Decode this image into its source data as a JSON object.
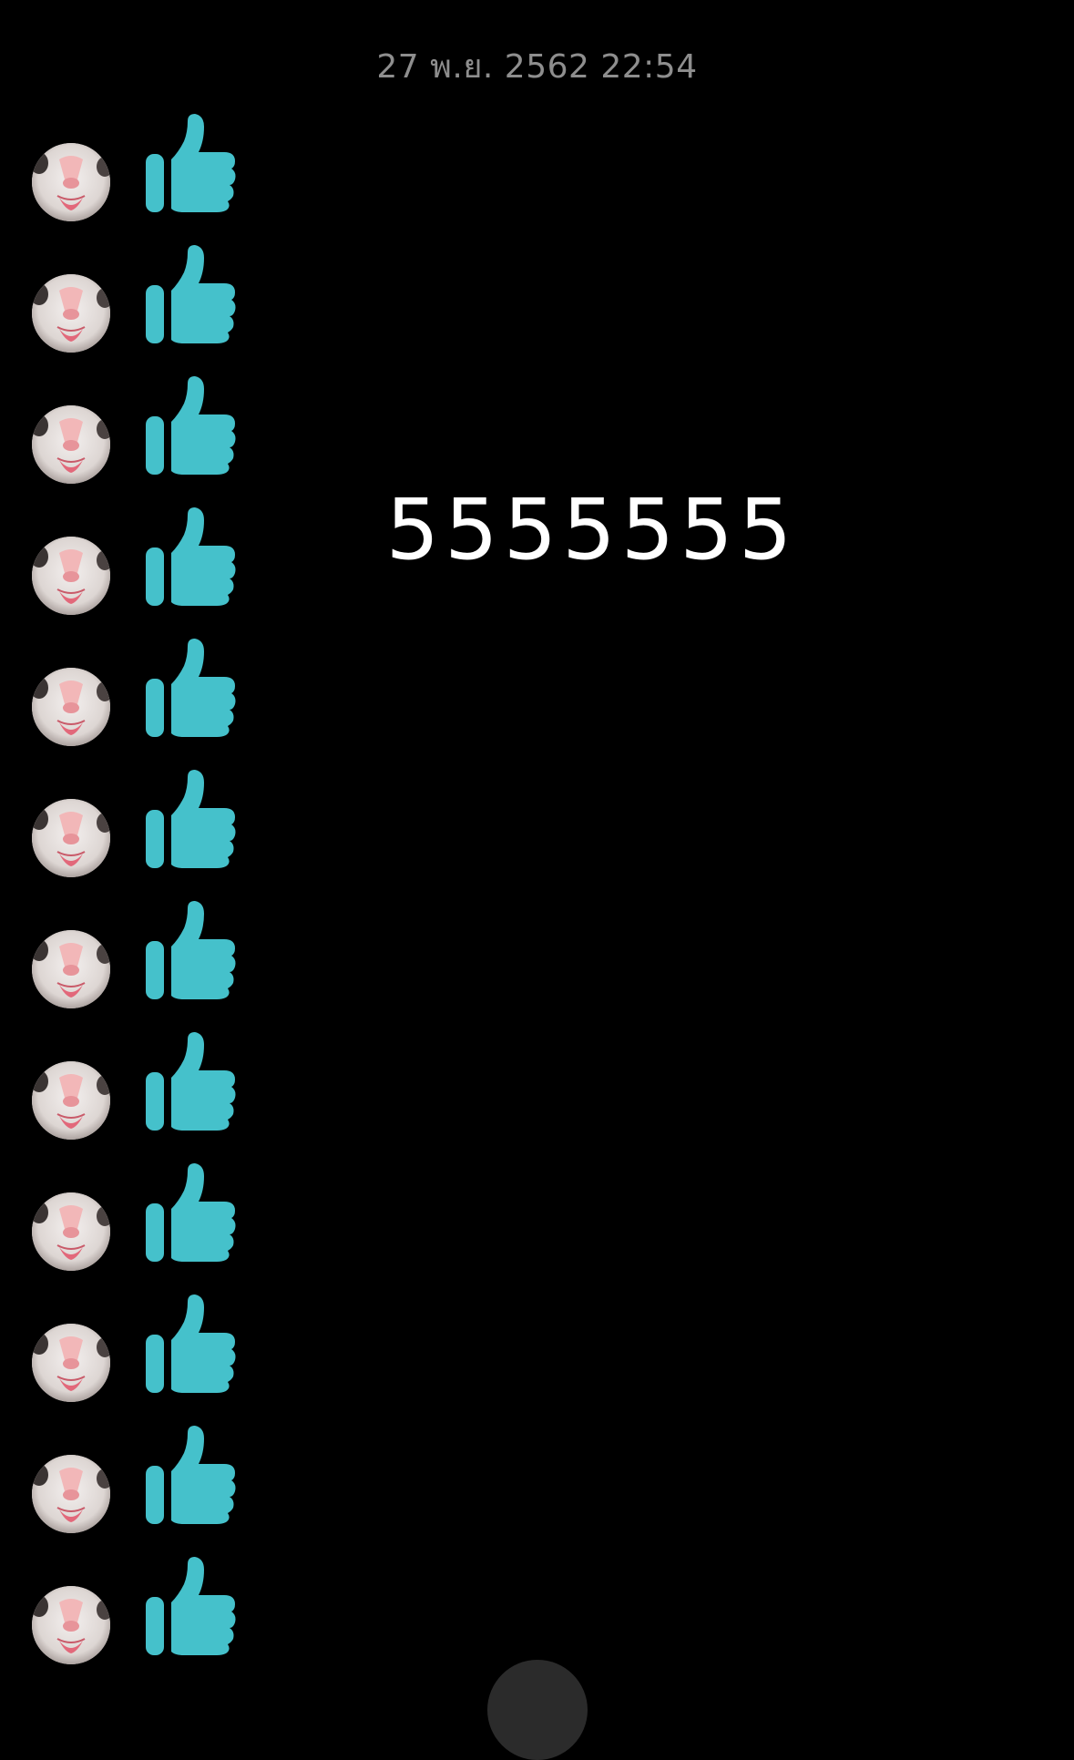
{
  "chat": {
    "timestamp": "27 พ.ย. 2562 22:54",
    "message_text": "5555555",
    "like_count_rows": 12,
    "like_icon": "thumbs-up-icon",
    "like_color": "#45c1cb"
  },
  "avatar": {
    "description_icon": "avatar-cat-icon"
  }
}
